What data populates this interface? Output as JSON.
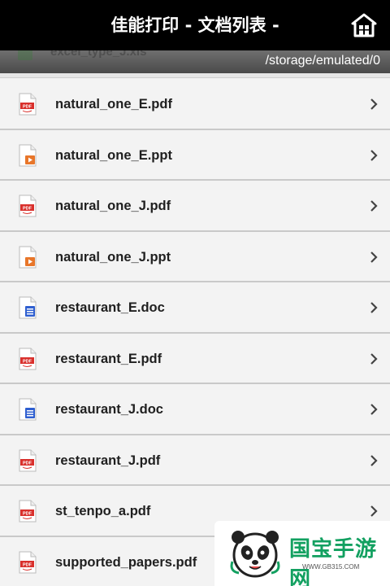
{
  "header": {
    "title": "佳能打印 - 文档列表 -",
    "home_icon": "home-icon"
  },
  "path_bar": {
    "partial_file": "excel_type_J.xls",
    "path": "/storage/emulated/0"
  },
  "files": [
    {
      "name": "natural_one_E.pdf",
      "type": "pdf"
    },
    {
      "name": "natural_one_E.ppt",
      "type": "ppt"
    },
    {
      "name": "natural_one_J.pdf",
      "type": "pdf"
    },
    {
      "name": "natural_one_J.ppt",
      "type": "ppt"
    },
    {
      "name": "restaurant_E.doc",
      "type": "doc"
    },
    {
      "name": "restaurant_E.pdf",
      "type": "pdf"
    },
    {
      "name": "restaurant_J.doc",
      "type": "doc"
    },
    {
      "name": "restaurant_J.pdf",
      "type": "pdf"
    },
    {
      "name": "st_tenpo_a.pdf",
      "type": "pdf"
    },
    {
      "name": "supported_papers.pdf",
      "type": "pdf"
    }
  ],
  "watermark": {
    "text": "国宝手游网",
    "url": "WWW.GB315.COM"
  },
  "colors": {
    "titlebar": "#000000",
    "pdf_icon": "#d9302c",
    "ppt_icon": "#e8762a",
    "doc_icon": "#2f5fd0",
    "watermark_green": "#12a060"
  }
}
